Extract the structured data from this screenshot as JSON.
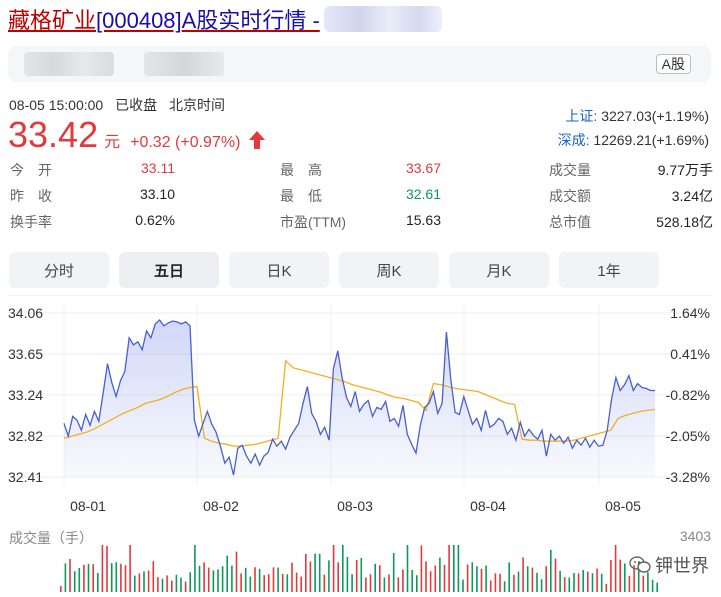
{
  "header": {
    "stock_name": "藏格矿业",
    "stock_code": "[000408]",
    "title_suffix": "A股实时行情 -"
  },
  "info_bar": {
    "market_badge": "A股"
  },
  "quote": {
    "datetime": "08-05 15:00:00",
    "status": "已收盘",
    "timezone": "北京时间",
    "price": "33.42",
    "unit": "元",
    "change": "+0.32 (+0.97%)"
  },
  "indices": [
    {
      "name": "上证:",
      "value": "3227.03(+1.19%)"
    },
    {
      "name": "深成:",
      "value": "12269.21(+1.69%)"
    }
  ],
  "stats": [
    [
      {
        "label": "今　开",
        "value": "33.11",
        "tone": "red"
      },
      {
        "label": "最　高",
        "value": "33.67",
        "tone": "red"
      },
      {
        "label": "成交量",
        "value": "9.77万手"
      }
    ],
    [
      {
        "label": "昨　收",
        "value": "33.10",
        "tone": "dark"
      },
      {
        "label": "最　低",
        "value": "32.61",
        "tone": "green"
      },
      {
        "label": "成交额",
        "value": "3.24亿"
      }
    ],
    [
      {
        "label": "换手率",
        "value": "0.62%",
        "tone": "dark"
      },
      {
        "label": "市盈(TTM)",
        "value": "15.63",
        "tone": "dark"
      },
      {
        "label": "总市值",
        "value": "528.18亿"
      }
    ]
  ],
  "tabs": [
    {
      "label": "分时",
      "active": false
    },
    {
      "label": "五日",
      "active": true
    },
    {
      "label": "日K",
      "active": false
    },
    {
      "label": "周K",
      "active": false
    },
    {
      "label": "月K",
      "active": false
    },
    {
      "label": "1年",
      "active": false
    }
  ],
  "chart_data": {
    "type": "line",
    "title": "",
    "y_left_ticks": [
      "34.06",
      "33.65",
      "33.24",
      "32.82",
      "32.41"
    ],
    "y_right_ticks": [
      "1.64%",
      "0.41%",
      "-0.82%",
      "-2.05%",
      "-3.28%"
    ],
    "ylim": [
      32.41,
      34.06
    ],
    "x_labels": [
      "08-01",
      "08-02",
      "08-03",
      "08-04",
      "08-05"
    ],
    "series": [
      {
        "values": [
          32.95,
          32.82,
          33.02,
          32.98,
          32.88,
          33.04,
          32.93,
          33.07,
          32.97,
          33.25,
          33.55,
          33.36,
          33.22,
          33.38,
          33.47,
          33.81,
          33.74,
          33.77,
          33.69,
          33.88,
          33.81,
          33.95,
          33.99,
          33.93,
          33.96,
          33.98,
          33.97,
          33.95,
          33.97,
          33.93,
          32.98,
          32.82,
          32.95,
          33.07,
          32.94,
          32.86,
          32.72,
          32.55,
          32.61,
          32.43,
          32.7,
          32.73,
          32.62,
          32.55,
          32.64,
          32.53,
          32.62,
          32.66,
          32.79,
          32.72,
          32.77,
          32.69,
          32.81,
          32.88,
          32.95,
          33.15,
          33.32,
          33.05,
          32.97,
          32.84,
          32.91,
          32.78,
          33.5,
          33.68,
          33.41,
          33.21,
          33.12,
          33.27,
          33.07,
          33.14,
          33.18,
          33.02,
          33.11,
          33.09,
          33.17,
          32.97,
          33.0,
          32.92,
          33.13,
          32.84,
          32.74,
          32.65,
          32.93,
          33.11,
          33.15,
          33.27,
          33.05,
          33.15,
          33.87,
          33.39,
          33.06,
          33.04,
          33.22,
          33.08,
          32.94,
          33.0,
          32.88,
          33.08,
          32.91,
          32.94,
          33.0,
          32.97,
          32.84,
          32.9,
          32.78,
          32.96,
          32.82,
          32.89,
          32.83,
          32.79,
          32.88,
          32.62,
          32.84,
          32.78,
          32.82,
          32.75,
          32.81,
          32.7,
          32.78,
          32.73,
          32.8,
          32.71,
          32.78,
          32.72,
          32.73,
          32.88,
          33.19,
          33.41,
          33.28,
          33.34,
          33.43,
          33.28,
          33.35,
          33.31,
          33.3,
          33.28,
          33.28
        ]
      },
      {
        "values": [
          32.8,
          32.82,
          32.84,
          32.86,
          32.89,
          32.93,
          32.97,
          33.01,
          33.05,
          33.08,
          33.11,
          33.15,
          33.17,
          33.19,
          33.22,
          33.26,
          33.29,
          33.31,
          33.32,
          32.8,
          32.77,
          32.75,
          32.74,
          32.72,
          32.72,
          32.73,
          32.74,
          32.76,
          32.78,
          32.8,
          33.58,
          33.51,
          33.49,
          33.47,
          33.45,
          33.43,
          33.41,
          33.39,
          33.37,
          33.34,
          33.32,
          33.3,
          33.28,
          33.26,
          33.23,
          33.21,
          33.2,
          33.18,
          33.16,
          33.08,
          33.35,
          33.34,
          33.32,
          33.3,
          33.29,
          33.28,
          33.27,
          33.24,
          33.21,
          33.18,
          33.15,
          33.14,
          32.79,
          32.78,
          32.78,
          32.77,
          32.77,
          32.77,
          32.77,
          32.78,
          32.8,
          32.82,
          32.84,
          32.86,
          32.88,
          33.0,
          33.03,
          33.05,
          33.07,
          33.08,
          33.09
        ]
      }
    ],
    "volume_max": "3403"
  },
  "volume": {
    "label": "成交量（手）",
    "max": "3403"
  },
  "watermark": {
    "text": "钾世界"
  },
  "colors": {
    "up": "#e4393c",
    "down": "#0b9a5c",
    "price_line": "#4a5fcf",
    "avg_line": "#f2b01e",
    "link": "#1a62c8"
  }
}
